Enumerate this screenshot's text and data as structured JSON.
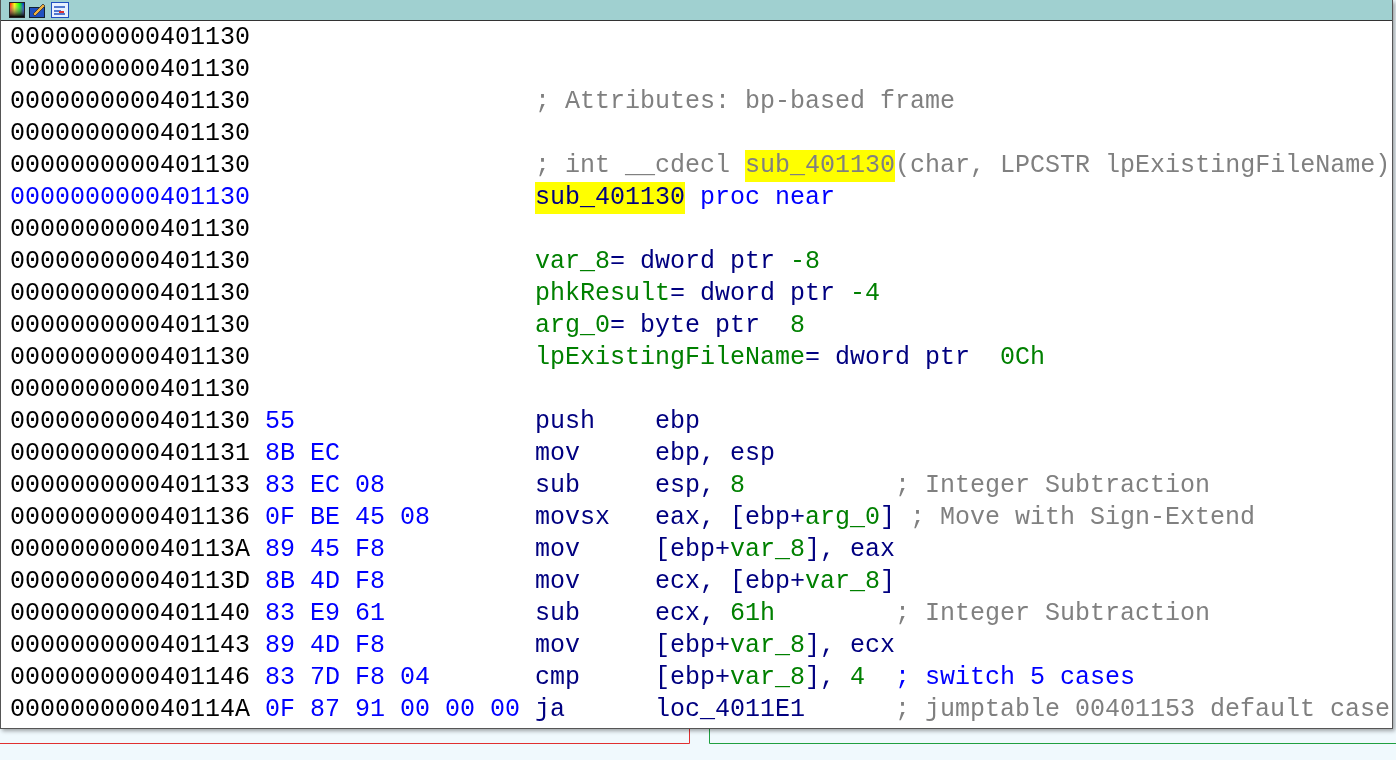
{
  "lines": [
    {
      "address": "0000000000401130",
      "label": false
    },
    {
      "address": "0000000000401130",
      "label": false
    },
    {
      "address": "0000000000401130",
      "label": false,
      "text": [
        {
          "text": "; Attributes: bp-based frame",
          "kind": "comment"
        }
      ]
    },
    {
      "address": "0000000000401130",
      "label": false
    },
    {
      "address": "0000000000401130",
      "label": false,
      "text": [
        {
          "text": "; int __cdecl ",
          "kind": "comment"
        },
        {
          "text": "sub_401130",
          "kind": "highlight_comment"
        },
        {
          "text": "(char, LPCSTR lpExistingFileName)",
          "kind": "comment"
        }
      ]
    },
    {
      "address": "0000000000401130",
      "label": true,
      "text": [
        {
          "text": "sub_401130",
          "kind": "highlight"
        },
        {
          "text": " proc near",
          "kind": "keyword"
        }
      ]
    },
    {
      "address": "0000000000401130",
      "label": false
    },
    {
      "address": "0000000000401130",
      "label": false,
      "text": [
        {
          "text": "var_8",
          "kind": "var"
        },
        {
          "text": "= dword ptr ",
          "kind": "reg"
        },
        {
          "text": "-8",
          "kind": "num"
        }
      ]
    },
    {
      "address": "0000000000401130",
      "label": false,
      "text": [
        {
          "text": "phkResult",
          "kind": "var"
        },
        {
          "text": "= dword ptr ",
          "kind": "reg"
        },
        {
          "text": "-4",
          "kind": "num"
        }
      ]
    },
    {
      "address": "0000000000401130",
      "label": false,
      "text": [
        {
          "text": "arg_0",
          "kind": "var"
        },
        {
          "text": "= byte ptr  ",
          "kind": "reg"
        },
        {
          "text": "8",
          "kind": "num"
        }
      ]
    },
    {
      "address": "0000000000401130",
      "label": false,
      "text": [
        {
          "text": "lpExistingFileName",
          "kind": "var"
        },
        {
          "text": "= dword ptr  ",
          "kind": "reg"
        },
        {
          "text": "0Ch",
          "kind": "num"
        }
      ]
    },
    {
      "address": "0000000000401130",
      "label": false
    },
    {
      "address": "0000000000401130",
      "label": false,
      "bytes": "55",
      "mnemonic": "push",
      "operands": [
        {
          "text": "ebp",
          "kind": "reg"
        }
      ]
    },
    {
      "address": "0000000000401131",
      "label": false,
      "bytes": "8B EC",
      "mnemonic": "mov",
      "operands": [
        {
          "text": "ebp, esp",
          "kind": "reg"
        }
      ]
    },
    {
      "address": "0000000000401133",
      "label": false,
      "bytes": "83 EC 08",
      "mnemonic": "sub",
      "operands": [
        {
          "text": "esp, ",
          "kind": "reg"
        },
        {
          "text": "8",
          "kind": "num"
        }
      ],
      "comment": [
        {
          "text": "; Integer Subtraction",
          "kind": "comment"
        }
      ]
    },
    {
      "address": "0000000000401136",
      "label": false,
      "bytes": "0F BE 45 08",
      "mnemonic": "movsx",
      "operands": [
        {
          "text": "eax, [ebp+",
          "kind": "reg"
        },
        {
          "text": "arg_0",
          "kind": "var"
        },
        {
          "text": "]",
          "kind": "reg"
        }
      ],
      "comment": [
        {
          "text": "; Move with Sign-Extend",
          "kind": "comment"
        }
      ]
    },
    {
      "address": "000000000040113A",
      "label": false,
      "bytes": "89 45 F8",
      "mnemonic": "mov",
      "operands": [
        {
          "text": "[ebp+",
          "kind": "reg"
        },
        {
          "text": "var_8",
          "kind": "var"
        },
        {
          "text": "], eax",
          "kind": "reg"
        }
      ]
    },
    {
      "address": "000000000040113D",
      "label": false,
      "bytes": "8B 4D F8",
      "mnemonic": "mov",
      "operands": [
        {
          "text": "ecx, [ebp+",
          "kind": "reg"
        },
        {
          "text": "var_8",
          "kind": "var"
        },
        {
          "text": "]",
          "kind": "reg"
        }
      ]
    },
    {
      "address": "0000000000401140",
      "label": false,
      "bytes": "83 E9 61",
      "mnemonic": "sub",
      "operands": [
        {
          "text": "ecx, ",
          "kind": "reg"
        },
        {
          "text": "61h",
          "kind": "num"
        }
      ],
      "comment": [
        {
          "text": "; Integer Subtraction",
          "kind": "comment"
        }
      ]
    },
    {
      "address": "0000000000401143",
      "label": false,
      "bytes": "89 4D F8",
      "mnemonic": "mov",
      "operands": [
        {
          "text": "[ebp+",
          "kind": "reg"
        },
        {
          "text": "var_8",
          "kind": "var"
        },
        {
          "text": "], ecx",
          "kind": "reg"
        }
      ]
    },
    {
      "address": "0000000000401146",
      "label": false,
      "bytes": "83 7D F8 04",
      "mnemonic": "cmp",
      "operands": [
        {
          "text": "[ebp+",
          "kind": "reg"
        },
        {
          "text": "var_8",
          "kind": "var"
        },
        {
          "text": "], ",
          "kind": "reg"
        },
        {
          "text": "4",
          "kind": "num"
        }
      ],
      "comment": [
        {
          "text": "; switch 5 cases",
          "kind": "keyword"
        }
      ]
    },
    {
      "address": "000000000040114A",
      "label": false,
      "bytes": "0F 87 91 00 00 00",
      "mnemonic": "ja",
      "operands": [
        {
          "text": "loc_4011E1",
          "kind": "reg"
        }
      ],
      "comment": [
        {
          "text": "; jumptable 00401153 default case",
          "kind": "comment"
        }
      ]
    }
  ]
}
